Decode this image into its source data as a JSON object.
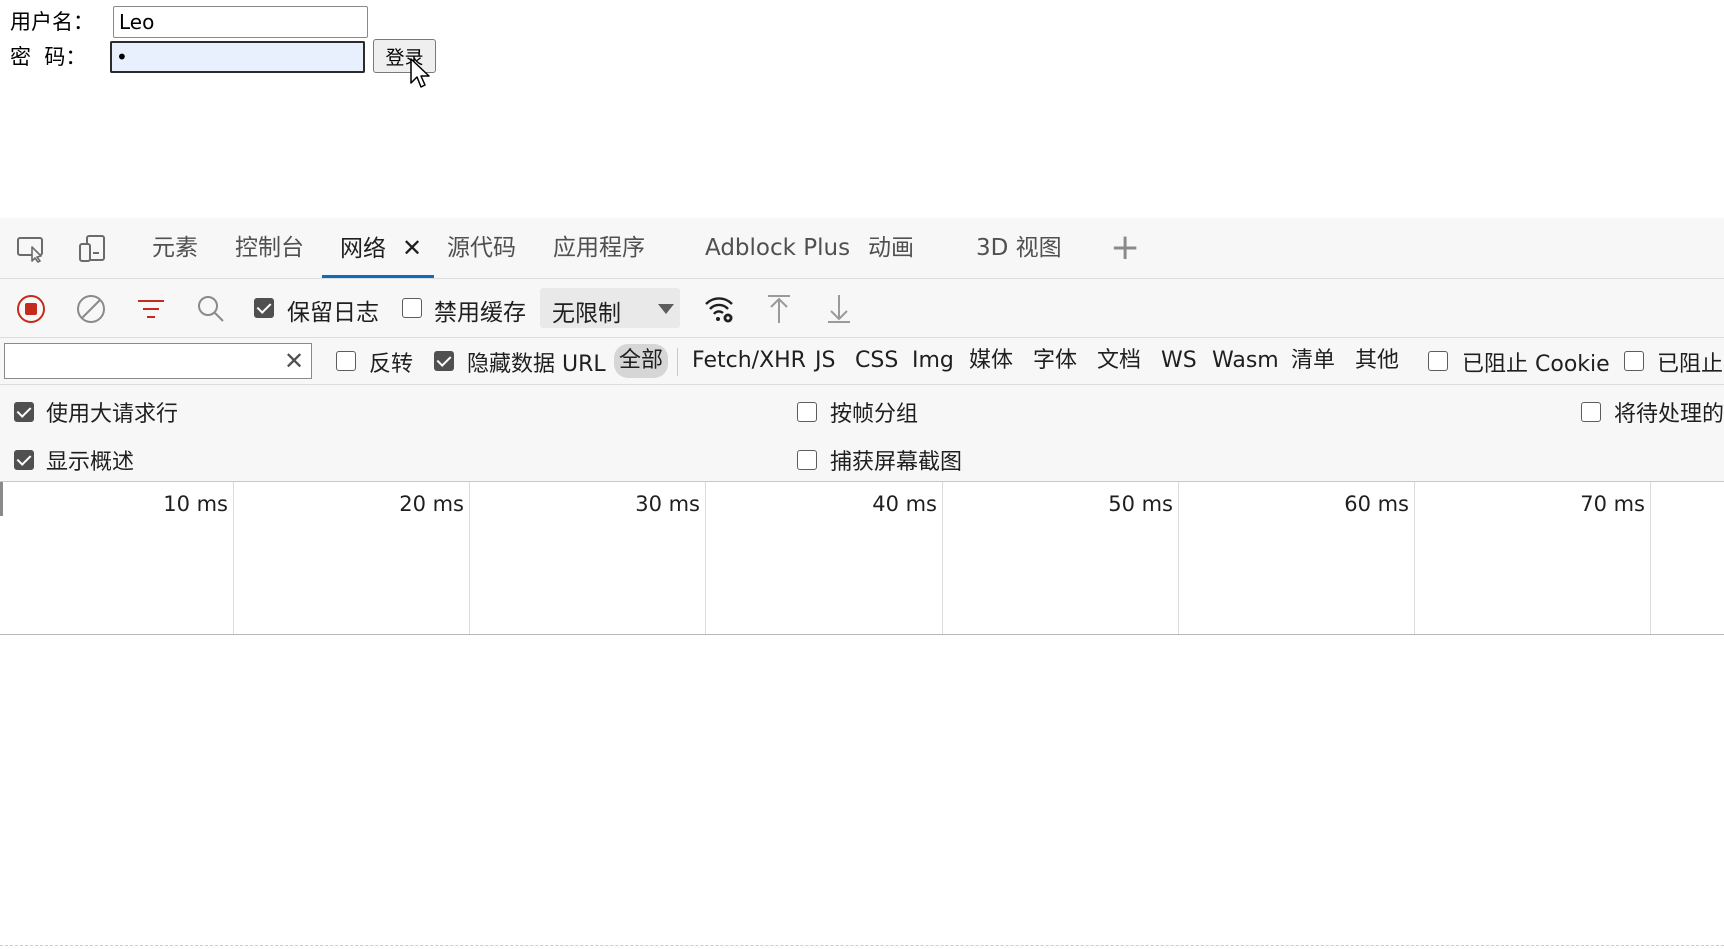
{
  "login": {
    "username_label": "用户名：",
    "password_label": "密  码：",
    "username_value": "Leo",
    "password_value": "•",
    "login_button": "登录"
  },
  "devtools": {
    "tabs": [
      {
        "label": "元素"
      },
      {
        "label": "控制台"
      },
      {
        "label": "网络",
        "active": true
      },
      {
        "label": "源代码"
      },
      {
        "label": "应用程序"
      },
      {
        "label": "Adblock Plus"
      },
      {
        "label": "动画"
      },
      {
        "label": "3D 视图"
      }
    ],
    "close_glyph": "✕",
    "add_glyph": "+",
    "toolbar": {
      "preserve_log": "保留日志",
      "disable_cache": "禁用缓存",
      "throttling": "无限制"
    },
    "filter": {
      "placeholder": "",
      "invert": "反转",
      "hide_data_url": "隐藏数据 URL",
      "types": [
        "全部",
        "Fetch/XHR",
        "JS",
        "CSS",
        "Img",
        "媒体",
        "字体",
        "文档",
        "WS",
        "Wasm",
        "清单",
        "其他"
      ],
      "blocked_cookies": "已阻止 Cookie",
      "blocked_requests": "已阻止"
    },
    "settings": {
      "large_rows": "使用大请求行",
      "show_overview": "显示概述",
      "group_by_frame": "按帧分组",
      "capture_screenshots": "捕获屏幕截图",
      "pending": "将待处理的"
    },
    "timeline": {
      "ticks": [
        "10 ms",
        "20 ms",
        "30 ms",
        "40 ms",
        "50 ms",
        "60 ms",
        "70 ms"
      ]
    },
    "colors": {
      "accent": "#0f6cbd",
      "record": "#c42b1c",
      "filter_icon": "#c42b1c"
    }
  }
}
